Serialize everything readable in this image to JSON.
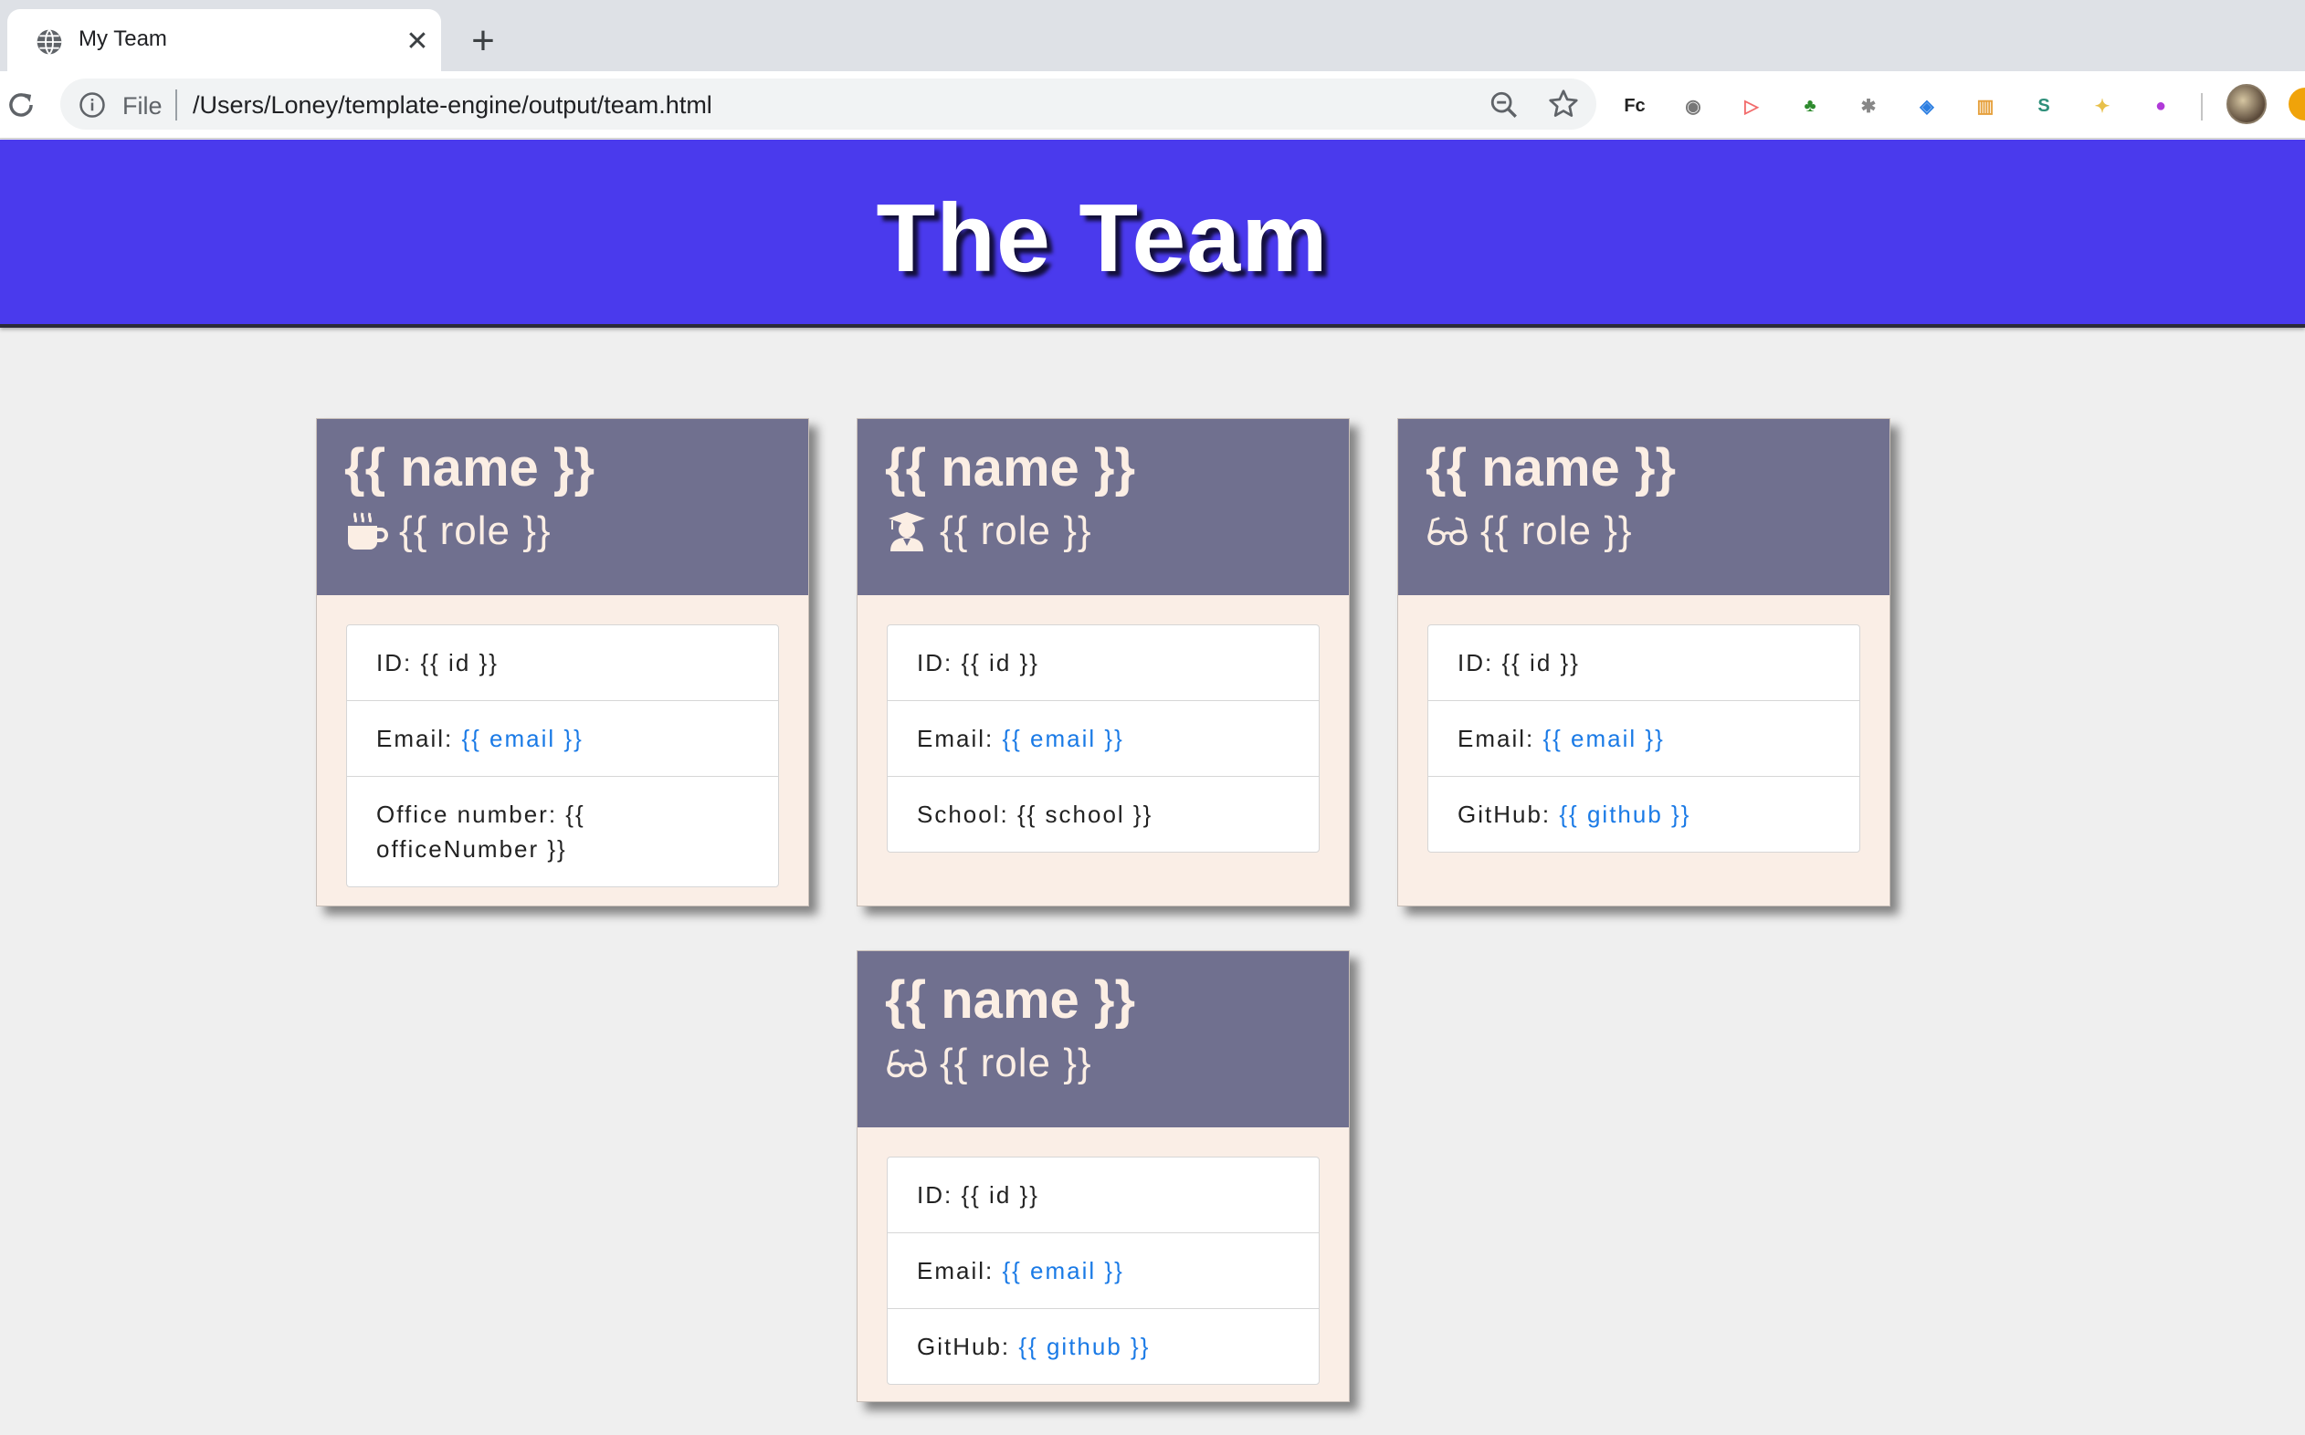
{
  "browser": {
    "tab_title": "My Team",
    "new_tab_label": "+",
    "close_label": "✕",
    "omnibox_scheme": "File",
    "url": "/Users/Loney/template-engine/output/team.html",
    "extensions": [
      {
        "name": "fc-extension-icon",
        "glyph": "Fc",
        "color": "#222222"
      },
      {
        "name": "film-reel-extension-icon",
        "glyph": "◉",
        "color": "#777777"
      },
      {
        "name": "arrow-extension-icon",
        "glyph": "▷",
        "color": "#f26b6b"
      },
      {
        "name": "html-tree-extension-icon",
        "glyph": "♣",
        "color": "#2e8b2e"
      },
      {
        "name": "bug-extension-icon",
        "glyph": "✱",
        "color": "#888888"
      },
      {
        "name": "shield-extension-icon",
        "glyph": "◈",
        "color": "#2a7de1"
      },
      {
        "name": "color-bars-extension-icon",
        "glyph": "▥",
        "color": "#e6a03c"
      },
      {
        "name": "s-extension-icon",
        "glyph": "S",
        "color": "#2e8f7a"
      },
      {
        "name": "lightbulb-extension-icon",
        "glyph": "✦",
        "color": "#e8c04a"
      },
      {
        "name": "purple-circle-extension-icon",
        "glyph": "●",
        "color": "#b03ad8"
      }
    ]
  },
  "header": {
    "title": "The Team"
  },
  "colors": {
    "banner": "#4a3aed",
    "card_header": "#70708f",
    "card_body": "#faeee6",
    "link": "#1a7ae6"
  },
  "cards": [
    {
      "name": "{{ name }}",
      "role": "{{ role }}",
      "role_icon": "coffee-mug-icon",
      "items": [
        {
          "label": "ID: ",
          "value": "{{ id }}",
          "link": false
        },
        {
          "label": "Email: ",
          "value": "{{ email }}",
          "link": true
        },
        {
          "label": "Office number: ",
          "value": "{{ officeNumber }}",
          "link": false
        }
      ]
    },
    {
      "name": "{{ name }}",
      "role": "{{ role }}",
      "role_icon": "graduate-icon",
      "items": [
        {
          "label": "ID: ",
          "value": "{{ id }}",
          "link": false
        },
        {
          "label": "Email: ",
          "value": "{{ email }}",
          "link": true
        },
        {
          "label": "School: ",
          "value": "{{ school }}",
          "link": false
        }
      ]
    },
    {
      "name": "{{ name }}",
      "role": "{{ role }}",
      "role_icon": "glasses-icon",
      "items": [
        {
          "label": "ID: ",
          "value": "{{ id }}",
          "link": false
        },
        {
          "label": "Email: ",
          "value": "{{ email }}",
          "link": true
        },
        {
          "label": "GitHub: ",
          "value": "{{ github }}",
          "link": true
        }
      ]
    },
    {
      "name": "{{ name }}",
      "role": "{{ role }}",
      "role_icon": "glasses-icon",
      "items": [
        {
          "label": "ID: ",
          "value": "{{ id }}",
          "link": false
        },
        {
          "label": "Email: ",
          "value": "{{ email }}",
          "link": true
        },
        {
          "label": "GitHub: ",
          "value": "{{ github }}",
          "link": true
        }
      ]
    }
  ]
}
